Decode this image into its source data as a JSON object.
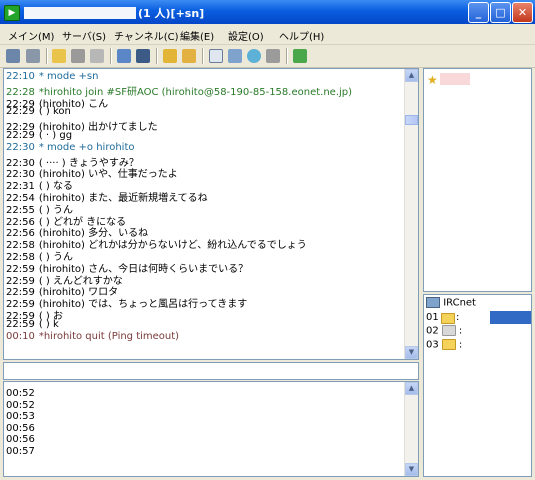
{
  "window": {
    "title": "(1 人)[+sn]"
  },
  "menu": [
    "メイン(M)",
    "サーバ(S)",
    "チャンネル(C)",
    "編集(E)",
    "設定(O)",
    "ヘルプ(H)"
  ],
  "chat": [
    {
      "time": "22:10",
      "text": "*         mode +sn",
      "kind": "sys"
    },
    {
      "time": "22:28",
      "text": "*hirohito join #SF研AOC (hirohito@58-190-85-158.eonet.ne.jp)",
      "kind": "join"
    },
    {
      "time": "22:29",
      "text": "(hirohito) こん",
      "kind": "msg"
    },
    {
      "time": "22:29",
      "text": "(        ) kon",
      "kind": "msg"
    },
    {
      "time": "22:29",
      "text": "(hirohito) 出かけてました",
      "kind": "msg"
    },
    {
      "time": "22:29",
      "text": "(   ·   ) gg",
      "kind": "msg"
    },
    {
      "time": "22:30",
      "text": "*         mode +o hirohito",
      "kind": "sys"
    },
    {
      "time": "22:30",
      "text": "(  ····  ) きょうやすみ？",
      "kind": "msg"
    },
    {
      "time": "22:30",
      "text": "(hirohito) いや、仕事だったよ",
      "kind": "msg"
    },
    {
      "time": "22:31",
      "text": "(        ) なる",
      "kind": "msg"
    },
    {
      "time": "22:54",
      "text": "(hirohito) また、最近新規増えてるね",
      "kind": "msg"
    },
    {
      "time": "22:55",
      "text": "(        ) うん",
      "kind": "msg"
    },
    {
      "time": "22:56",
      "text": "(        ) どれが              きになる",
      "kind": "msg"
    },
    {
      "time": "22:56",
      "text": "(hirohito) 多分、いるね",
      "kind": "msg"
    },
    {
      "time": "22:58",
      "text": "(hirohito) どれかは分からないけど、紛れ込んでるでしょう",
      "kind": "msg"
    },
    {
      "time": "22:58",
      "text": "(        ) うん",
      "kind": "msg"
    },
    {
      "time": "22:59",
      "text": "(hirohito)         さん、今日は何時くらいまでいる？",
      "kind": "msg"
    },
    {
      "time": "22:59",
      "text": "(      ) えんどれすかな",
      "kind": "msg"
    },
    {
      "time": "22:59",
      "text": "(hirohito) ワロタ",
      "kind": "msg"
    },
    {
      "time": "22:59",
      "text": "(hirohito) では、ちょっと風呂は行ってきます",
      "kind": "msg"
    },
    {
      "time": "22:59",
      "text": "(        ) お",
      "kind": "msg"
    },
    {
      "time": "22:59",
      "text": "(        ) k",
      "kind": "msg"
    },
    {
      "time": "00:10",
      "text": "*hirohito quit (Ping timeout)",
      "kind": "quit"
    }
  ],
  "log": [
    "00:52",
    "00:52",
    "00:53",
    "00:56",
    "00:56",
    "00:57"
  ],
  "channels": {
    "server": "IRCnet",
    "items": [
      {
        "num": "01",
        "name": ":"
      },
      {
        "num": "02",
        "name": ":"
      },
      {
        "num": "03",
        "name": ":"
      }
    ]
  },
  "colors": {
    "titlebar": "#0a5ee0",
    "selected": "#316ac5"
  }
}
